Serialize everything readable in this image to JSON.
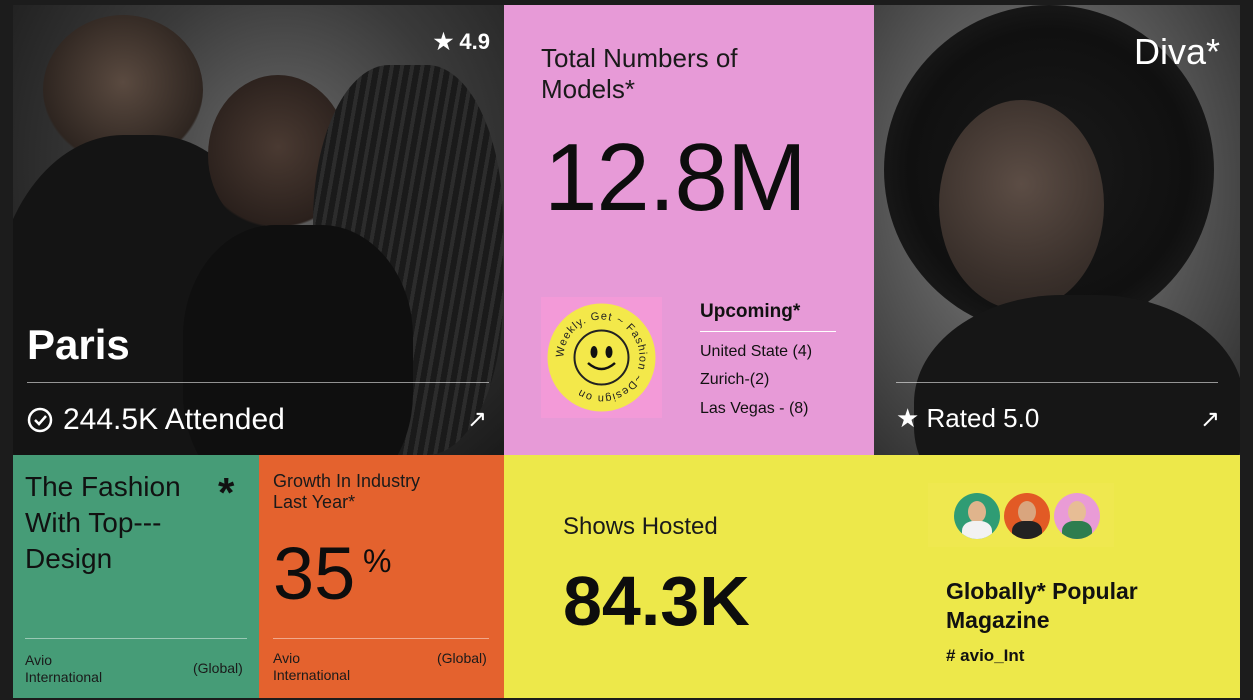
{
  "colors": {
    "pink": "#e79ad7",
    "green": "#469c77",
    "orange": "#e4622e",
    "yellow": "#ede84a",
    "dark": "#1c1c1c"
  },
  "paris_card": {
    "rating": "★ 4.9",
    "title": "Paris",
    "attended": "244.5K Attended",
    "icon": "badge-icon",
    "link_icon": "arrow-up-right-icon"
  },
  "models_card": {
    "label": "Total Numbers of Models*",
    "value": "12.8M",
    "badge_text": "Weekly. Get ~ Fashion ~Design on",
    "upcoming_title": "Upcoming*",
    "upcoming": [
      "United State (4)",
      "Zurich-(2)",
      "Las Vegas - (8)"
    ]
  },
  "diva_card": {
    "title": "Diva*",
    "rated": "★ Rated 5.0",
    "link_icon": "arrow-up-right-icon"
  },
  "fashion_card": {
    "title": "The Fashion With Top--- Design",
    "asterisk": "*",
    "company": "Avio International",
    "scope": "(Global)"
  },
  "growth_card": {
    "label": "Growth In Industry Last Year*",
    "value": "35",
    "unit": "%",
    "company": "Avio International",
    "scope": "(Global)"
  },
  "shows_card": {
    "label": "Shows Hosted",
    "value": "84.3K",
    "magazine_title": "Globally* Popular Magazine",
    "hashtag": "# avio_Int"
  }
}
